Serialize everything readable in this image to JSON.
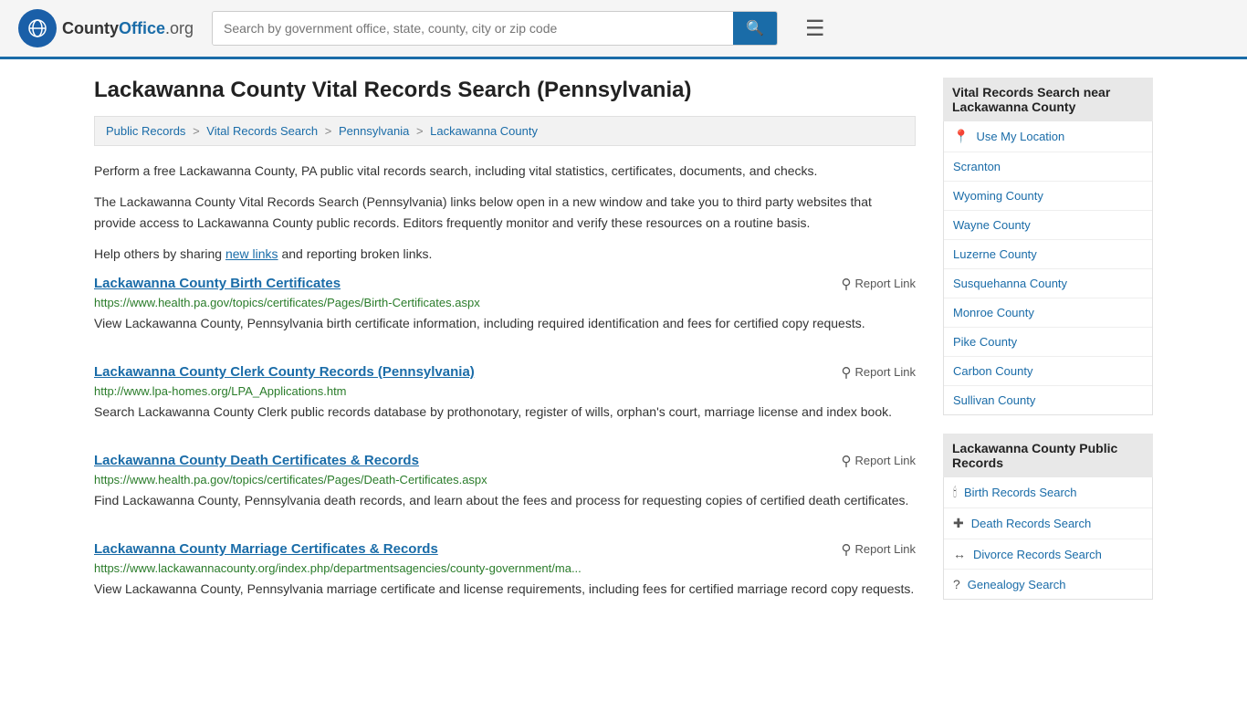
{
  "header": {
    "logo_text": "CountyOffice",
    "logo_suffix": ".org",
    "search_placeholder": "Search by government office, state, county, city or zip code"
  },
  "page": {
    "title": "Lackawanna County Vital Records Search (Pennsylvania)"
  },
  "breadcrumb": {
    "items": [
      {
        "label": "Public Records",
        "url": "#"
      },
      {
        "label": "Vital Records Search",
        "url": "#"
      },
      {
        "label": "Pennsylvania",
        "url": "#"
      },
      {
        "label": "Lackawanna County",
        "url": "#"
      }
    ]
  },
  "description": {
    "para1": "Perform a free Lackawanna County, PA public vital records search, including vital statistics, certificates, documents, and checks.",
    "para2": "The Lackawanna County Vital Records Search (Pennsylvania) links below open in a new window and take you to third party websites that provide access to Lackawanna County public records. Editors frequently monitor and verify these resources on a routine basis.",
    "para3_prefix": "Help others by sharing ",
    "para3_link": "new links",
    "para3_suffix": " and reporting broken links."
  },
  "results": [
    {
      "title": "Lackawanna County Birth Certificates",
      "url": "https://www.health.pa.gov/topics/certificates/Pages/Birth-Certificates.aspx",
      "desc": "View Lackawanna County, Pennsylvania birth certificate information, including required identification and fees for certified copy requests."
    },
    {
      "title": "Lackawanna County Clerk County Records (Pennsylvania)",
      "url": "http://www.lpa-homes.org/LPA_Applications.htm",
      "desc": "Search Lackawanna County Clerk public records database by prothonotary, register of wills, orphan's court, marriage license and index book."
    },
    {
      "title": "Lackawanna County Death Certificates & Records",
      "url": "https://www.health.pa.gov/topics/certificates/Pages/Death-Certificates.aspx",
      "desc": "Find Lackawanna County, Pennsylvania death records, and learn about the fees and process for requesting copies of certified death certificates."
    },
    {
      "title": "Lackawanna County Marriage Certificates & Records",
      "url": "https://www.lackawannacounty.org/index.php/departmentsagencies/county-government/ma...",
      "desc": "View Lackawanna County, Pennsylvania marriage certificate and license requirements, including fees for certified marriage record copy requests."
    }
  ],
  "report_label": "Report Link",
  "sidebar": {
    "section1": {
      "title": "Vital Records Search near Lackawanna County",
      "items": [
        {
          "icon": "📍",
          "label": "Use My Location",
          "url": "#"
        },
        {
          "icon": "",
          "label": "Scranton",
          "url": "#"
        },
        {
          "icon": "",
          "label": "Wyoming County",
          "url": "#"
        },
        {
          "icon": "",
          "label": "Wayne County",
          "url": "#"
        },
        {
          "icon": "",
          "label": "Luzerne County",
          "url": "#"
        },
        {
          "icon": "",
          "label": "Susquehanna County",
          "url": "#"
        },
        {
          "icon": "",
          "label": "Monroe County",
          "url": "#"
        },
        {
          "icon": "",
          "label": "Pike County",
          "url": "#"
        },
        {
          "icon": "",
          "label": "Carbon County",
          "url": "#"
        },
        {
          "icon": "",
          "label": "Sullivan County",
          "url": "#"
        }
      ]
    },
    "section2": {
      "title": "Lackawanna County Public Records",
      "items": [
        {
          "icon": "🕯",
          "label": "Birth Records Search",
          "url": "#"
        },
        {
          "icon": "✚",
          "label": "Death Records Search",
          "url": "#"
        },
        {
          "icon": "↔",
          "label": "Divorce Records Search",
          "url": "#"
        },
        {
          "icon": "?",
          "label": "Genealogy Search",
          "url": "#"
        }
      ]
    }
  }
}
